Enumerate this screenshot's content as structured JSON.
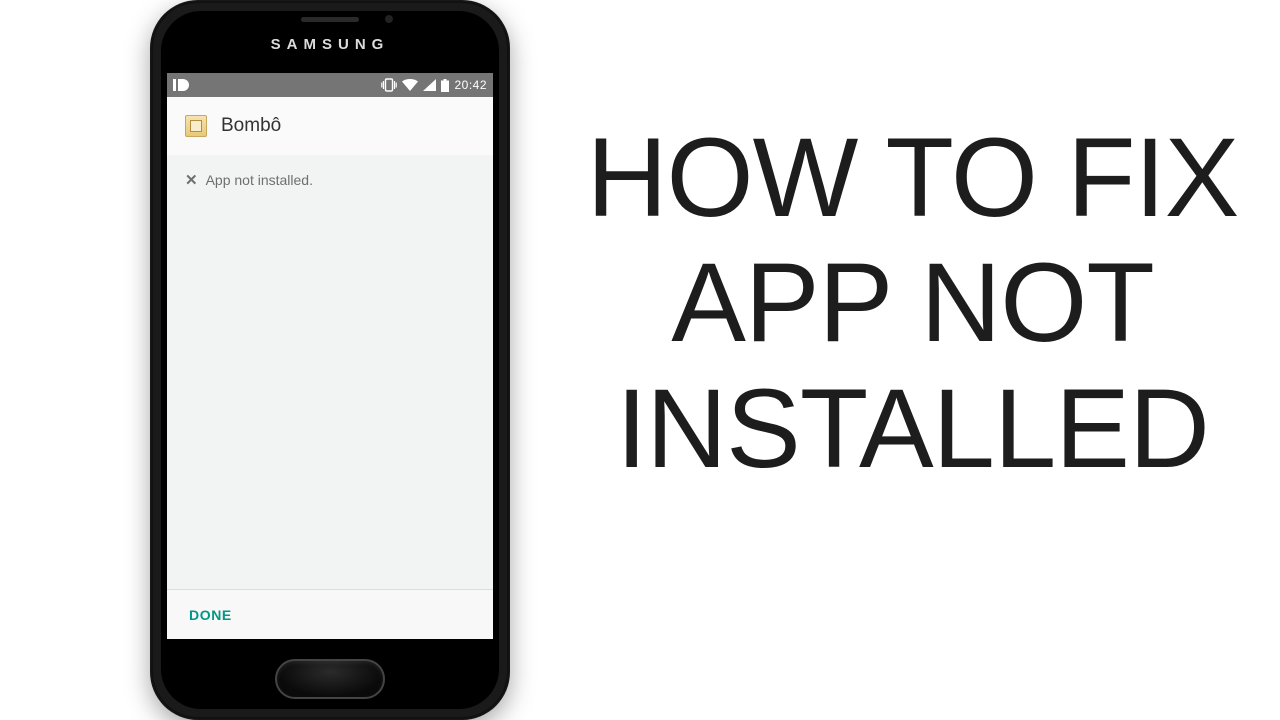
{
  "phone": {
    "brand": "SAMSUNG",
    "statusbar": {
      "clock": "20:42",
      "icons": {
        "notification": "id-icon",
        "vibrate": "vibrate-icon",
        "wifi": "wifi-icon",
        "cell": "cell-signal-icon",
        "battery": "battery-icon"
      }
    },
    "app": {
      "icon_name": "app-icon",
      "title": "Bombô",
      "message": "App not installed.",
      "done_label": "DONE"
    }
  },
  "headline": {
    "line1": "HOW TO FIX",
    "line2": "APP NOT",
    "line3": "INSTALLED"
  }
}
